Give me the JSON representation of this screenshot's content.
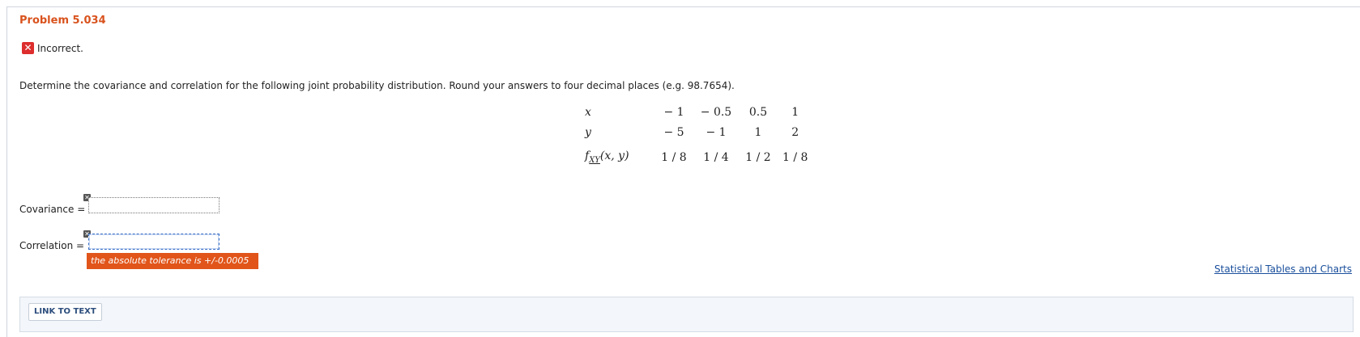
{
  "problem": {
    "title": "Problem 5.034",
    "status_text": "Incorrect.",
    "question": "Determine the covariance and correlation for the following joint probability distribution. Round your answers to four decimal places (e.g. 98.7654)."
  },
  "distribution": {
    "x_label": "x",
    "y_label": "y",
    "f_label": "f",
    "f_sub": "XY",
    "f_args": "(x, y)",
    "x_values": [
      "− 1",
      "− 0.5",
      "0.5",
      "1"
    ],
    "y_values": [
      "− 5",
      "− 1",
      "1",
      "2"
    ],
    "f_values": [
      "1 / 8",
      "1 / 4",
      "1 / 2",
      "1 / 8"
    ]
  },
  "fields": {
    "covariance_label": "Covariance =",
    "covariance_value": "",
    "correlation_label": "Correlation =",
    "correlation_value": ""
  },
  "tooltip": "the absolute tolerance is +/-0.0005",
  "links": {
    "statistical_tables": "Statistical Tables and Charts",
    "link_to_text": "LINK TO TEXT"
  },
  "icons": {
    "incorrect": "x-mark-icon",
    "clear": "clear-x-icon"
  },
  "colors": {
    "title": "#d9531e",
    "incorrect": "#dd2d2d",
    "tooltip": "#e1551a",
    "link": "#1a4f9c"
  }
}
